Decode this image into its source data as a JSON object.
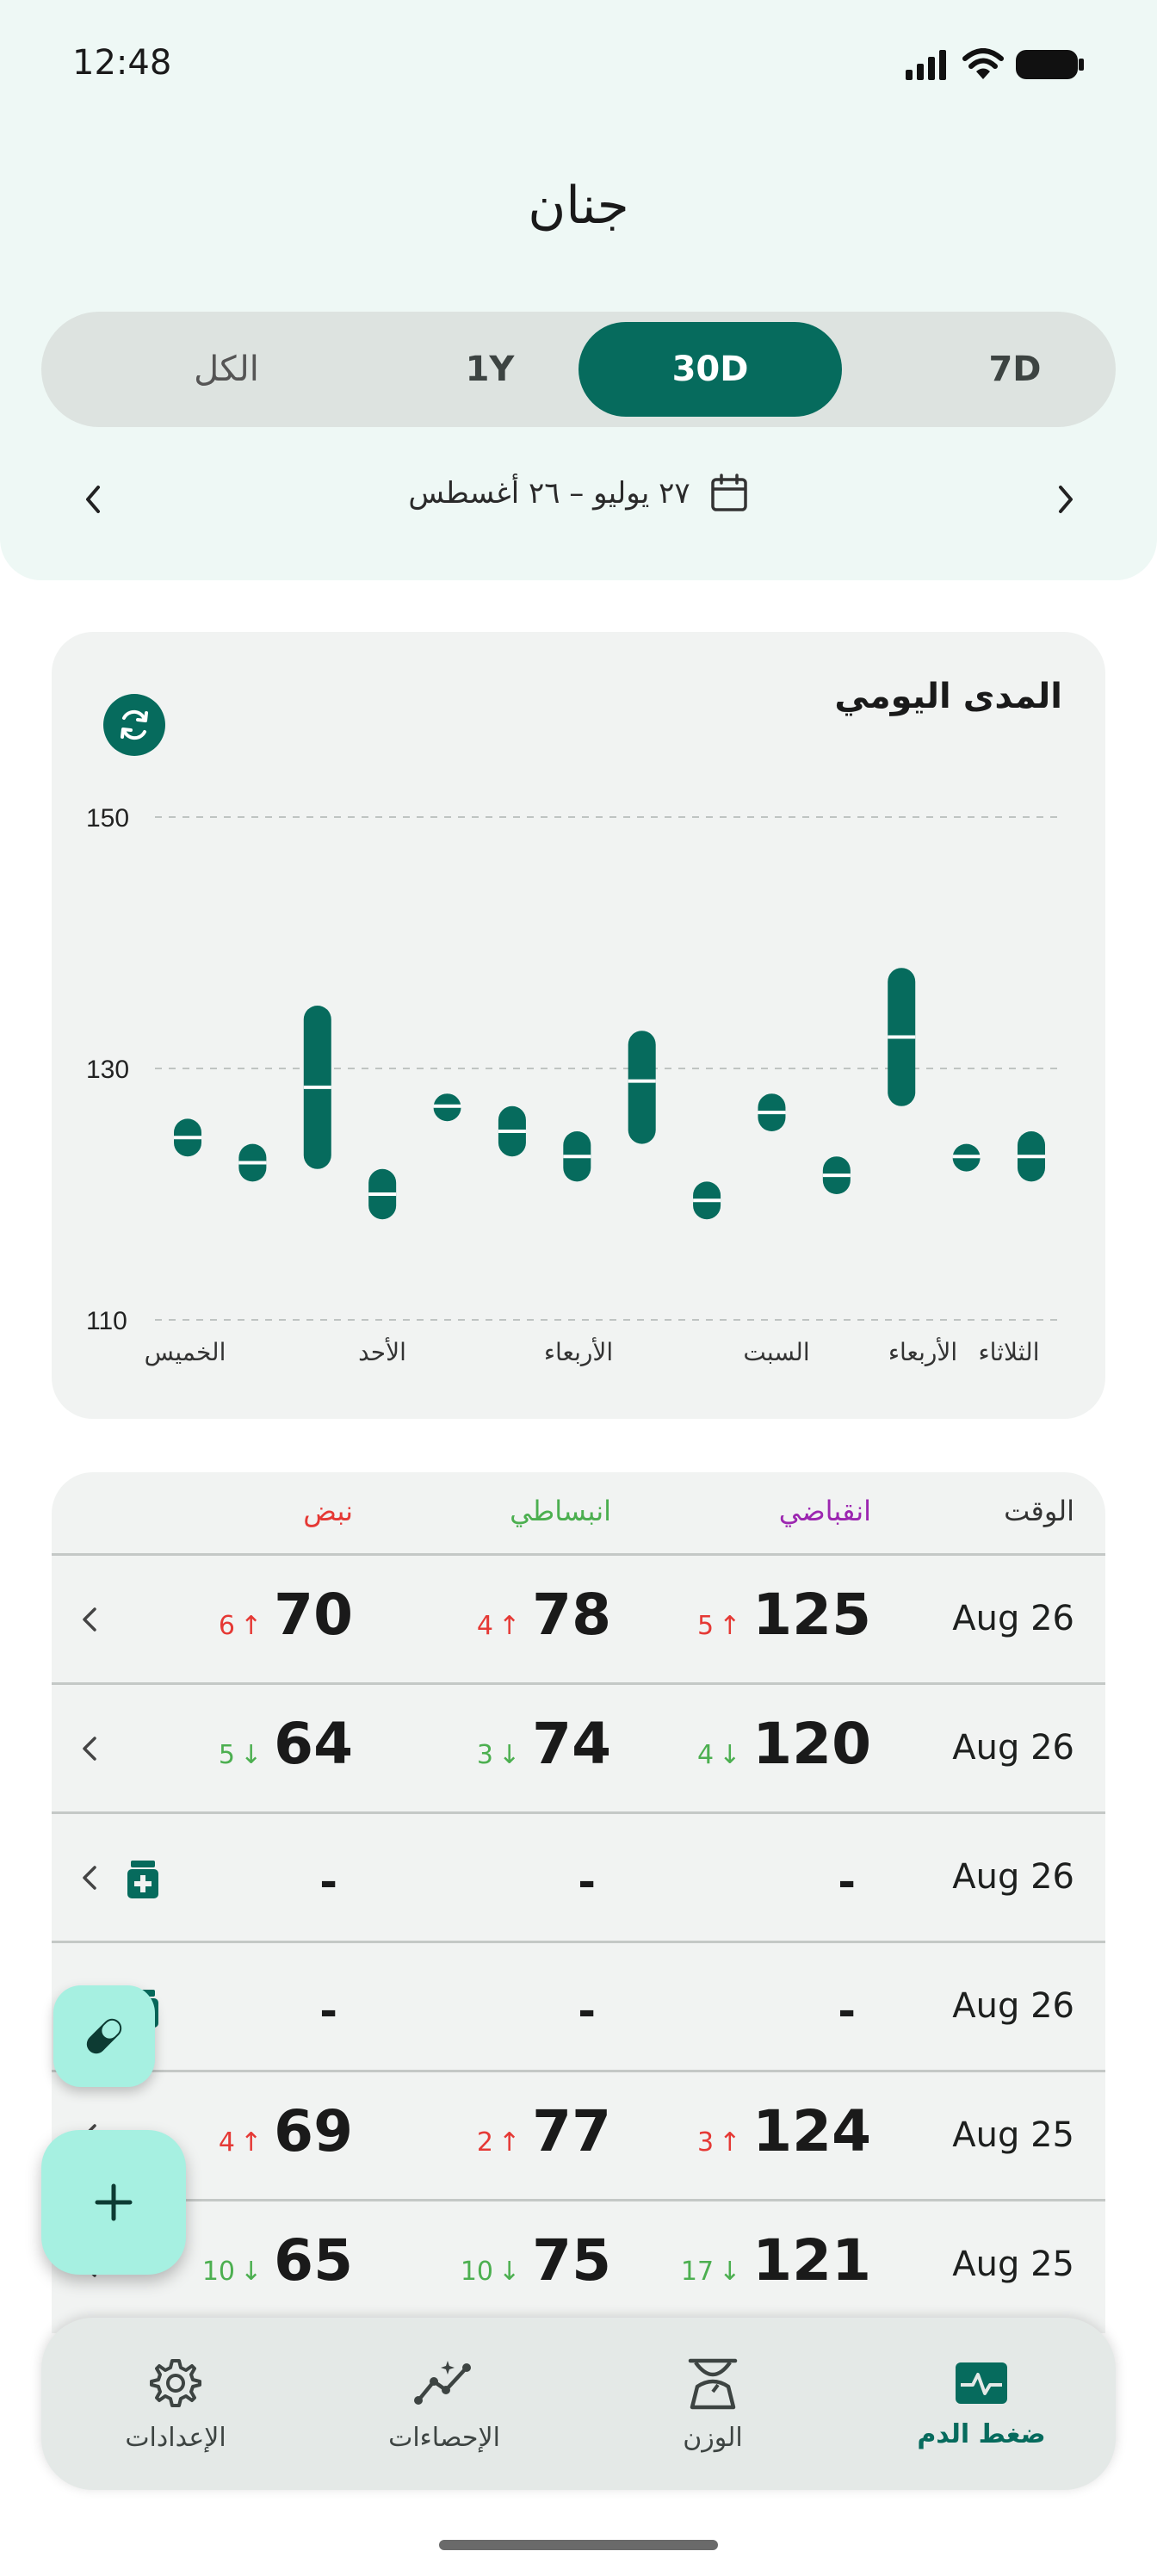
{
  "status": {
    "time": "12:48"
  },
  "header": {
    "title": "جنان"
  },
  "tabs": [
    {
      "label": "الكل",
      "active": false
    },
    {
      "label": "1Y",
      "active": false
    },
    {
      "label": "30D",
      "active": true
    },
    {
      "label": "7D",
      "active": false
    }
  ],
  "date_range": {
    "label": "٢٧ يوليو – ٢٦ أغسطس"
  },
  "chart": {
    "title": "المدى اليومي"
  },
  "chart_data": {
    "type": "range-bar",
    "title": "المدى اليومي",
    "ylim": [
      110,
      150
    ],
    "yticks": [
      "150",
      "130",
      "110"
    ],
    "xtick_labels": [
      "الخميس",
      "الأحد",
      "الأربعاء",
      "السبت",
      "الأربعاء",
      "الثلاثاء"
    ],
    "grid": true,
    "color": "#066b5d",
    "bars": [
      {
        "low": 123,
        "high": 126,
        "avg": 124.5
      },
      {
        "low": 121,
        "high": 124,
        "avg": 122.5
      },
      {
        "low": 122,
        "high": 135,
        "avg": 128.5
      },
      {
        "low": 118,
        "high": 122,
        "avg": 120
      },
      {
        "low": 126,
        "high": 128,
        "avg": 127
      },
      {
        "low": 123,
        "high": 127,
        "avg": 125
      },
      {
        "low": 121,
        "high": 125,
        "avg": 123
      },
      {
        "low": 124,
        "high": 133,
        "avg": 129
      },
      {
        "low": 118,
        "high": 121,
        "avg": 119.5
      },
      {
        "low": 125,
        "high": 128,
        "avg": 126.5
      },
      {
        "low": 120,
        "high": 123,
        "avg": 121.5
      },
      {
        "low": 127,
        "high": 138,
        "avg": 132.5
      },
      {
        "low": 122,
        "high": 124,
        "avg": 123
      },
      {
        "low": 121,
        "high": 125,
        "avg": 123
      }
    ]
  },
  "table": {
    "headers": {
      "time": "الوقت",
      "systolic": "انقباضي",
      "diastolic": "انبساطي",
      "pulse": "نبض"
    },
    "rows": [
      {
        "date": "Aug 26",
        "sys": "125",
        "sys_delta": "5",
        "sys_dir": "up",
        "dia": "78",
        "dia_delta": "4",
        "dia_dir": "up",
        "pulse": "70",
        "pulse_delta": "6",
        "pulse_dir": "up",
        "med": false
      },
      {
        "date": "Aug 26",
        "sys": "120",
        "sys_delta": "4",
        "sys_dir": "down",
        "dia": "74",
        "dia_delta": "3",
        "dia_dir": "down",
        "pulse": "64",
        "pulse_delta": "5",
        "pulse_dir": "down",
        "med": false
      },
      {
        "date": "Aug 26",
        "sys": "-",
        "dia": "-",
        "pulse": "-",
        "med": true
      },
      {
        "date": "Aug 26",
        "sys": "-",
        "dia": "-",
        "pulse": "-",
        "med": true
      },
      {
        "date": "Aug 25",
        "sys": "124",
        "sys_delta": "3",
        "sys_dir": "up",
        "dia": "77",
        "dia_delta": "2",
        "dia_dir": "up",
        "pulse": "69",
        "pulse_delta": "4",
        "pulse_dir": "up",
        "med": false
      },
      {
        "date": "Aug 25",
        "sys": "121",
        "sys_delta": "17",
        "sys_dir": "down",
        "dia": "75",
        "dia_delta": "10",
        "dia_dir": "down",
        "pulse": "65",
        "pulse_delta": "10",
        "pulse_dir": "down",
        "med": false
      }
    ]
  },
  "bottom_nav": [
    {
      "label": "الإعدادات",
      "icon": "gear-icon",
      "active": false
    },
    {
      "label": "الإحصاءات",
      "icon": "stats-icon",
      "active": false
    },
    {
      "label": "الوزن",
      "icon": "scale-icon",
      "active": false
    },
    {
      "label": "ضغط الدم",
      "icon": "heart-pulse-icon",
      "active": true
    }
  ]
}
